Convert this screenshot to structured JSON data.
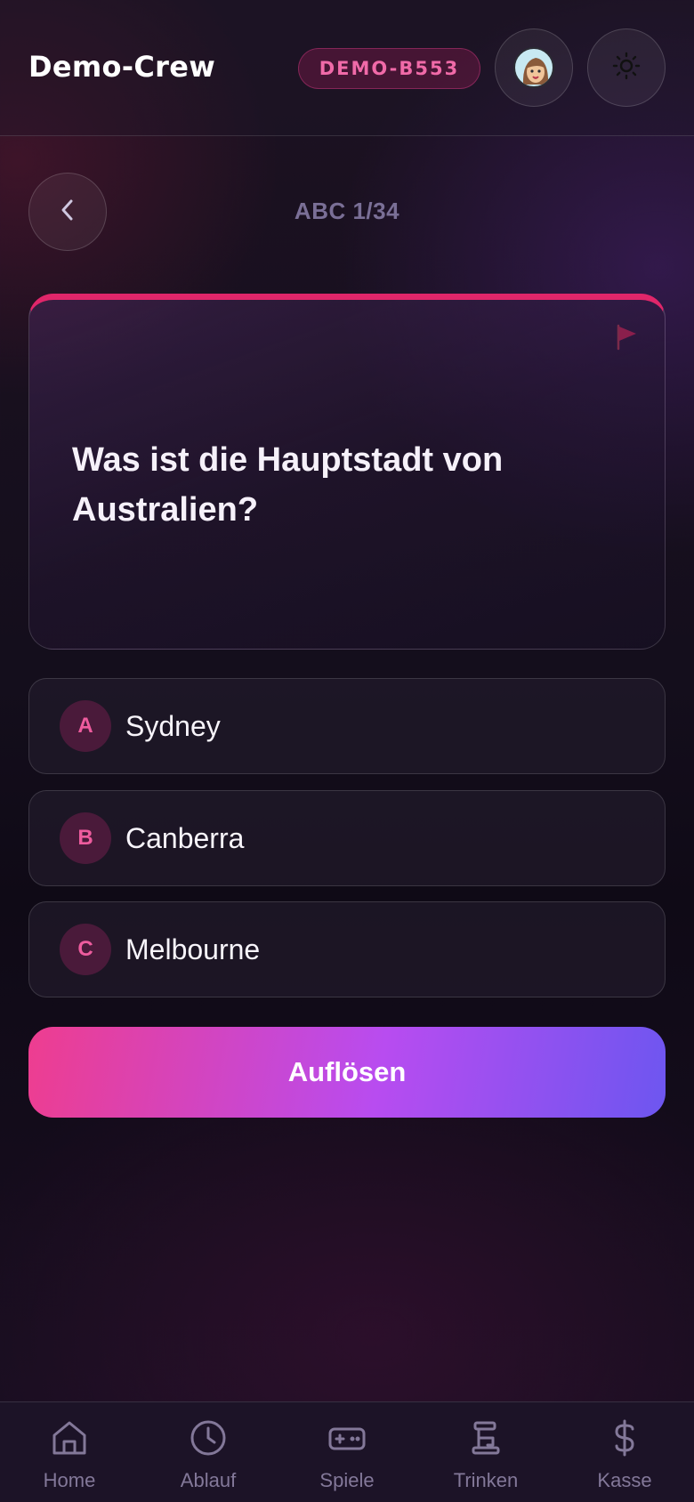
{
  "header": {
    "brand": "Demo-Crew",
    "session_code": "DEMO-B553",
    "avatar_icon": "avatar-icon",
    "theme_icon": "sun-icon"
  },
  "quiz": {
    "back_icon": "chevron-left-icon",
    "progress_label": "ABC 1/34",
    "flag_icon": "flag-icon",
    "question": "Was ist die Hauptstadt von Australien?",
    "options": [
      {
        "letter": "A",
        "text": "Sydney"
      },
      {
        "letter": "B",
        "text": "Canberra"
      },
      {
        "letter": "C",
        "text": "Melbourne"
      }
    ],
    "resolve_label": "Auflösen"
  },
  "nav": {
    "items": [
      {
        "label": "Home",
        "icon": "home-icon"
      },
      {
        "label": "Ablauf",
        "icon": "clock-icon"
      },
      {
        "label": "Spiele",
        "icon": "gamepad-icon"
      },
      {
        "label": "Trinken",
        "icon": "tap-icon"
      },
      {
        "label": "Kasse",
        "icon": "dollar-icon"
      }
    ]
  },
  "colors": {
    "accent_pink": "#e0266a",
    "badge_text": "#f06aa8",
    "button_gradient_start": "#ee3d8f",
    "button_gradient_end": "#6d56f0",
    "nav_text": "#837899"
  }
}
